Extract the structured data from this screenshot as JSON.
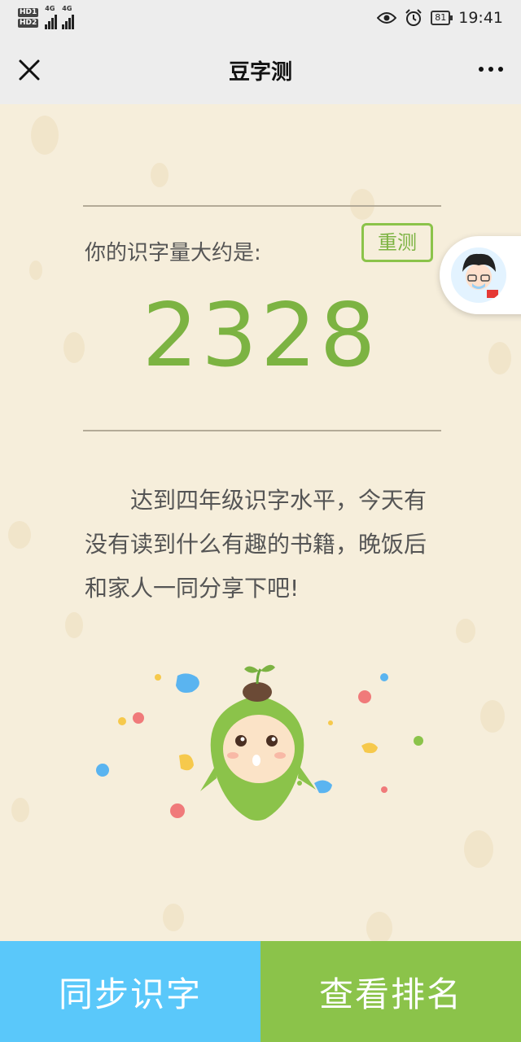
{
  "status_bar": {
    "time": "19:41",
    "battery": "81",
    "network_1": "4G",
    "network_2": "4G",
    "hd_1": "HD1",
    "hd_2": "HD2"
  },
  "header": {
    "title": "豆字测"
  },
  "result": {
    "label": "你的识字量大约是:",
    "retest_label": "重测",
    "score": "2328",
    "message": "达到四年级识字水平，今天有没有读到什么有趣的书籍，晚饭后和家人一同分享下吧!"
  },
  "footer": {
    "sync_label": "同步识字",
    "ranking_label": "查看排名"
  },
  "colors": {
    "accent_green": "#7cb342",
    "accent_blue": "#5ac8fa",
    "background": "#f6eedb"
  },
  "icons": {
    "close": "close-icon",
    "more": "more-icon",
    "eye": "eye-icon",
    "alarm": "alarm-icon"
  }
}
